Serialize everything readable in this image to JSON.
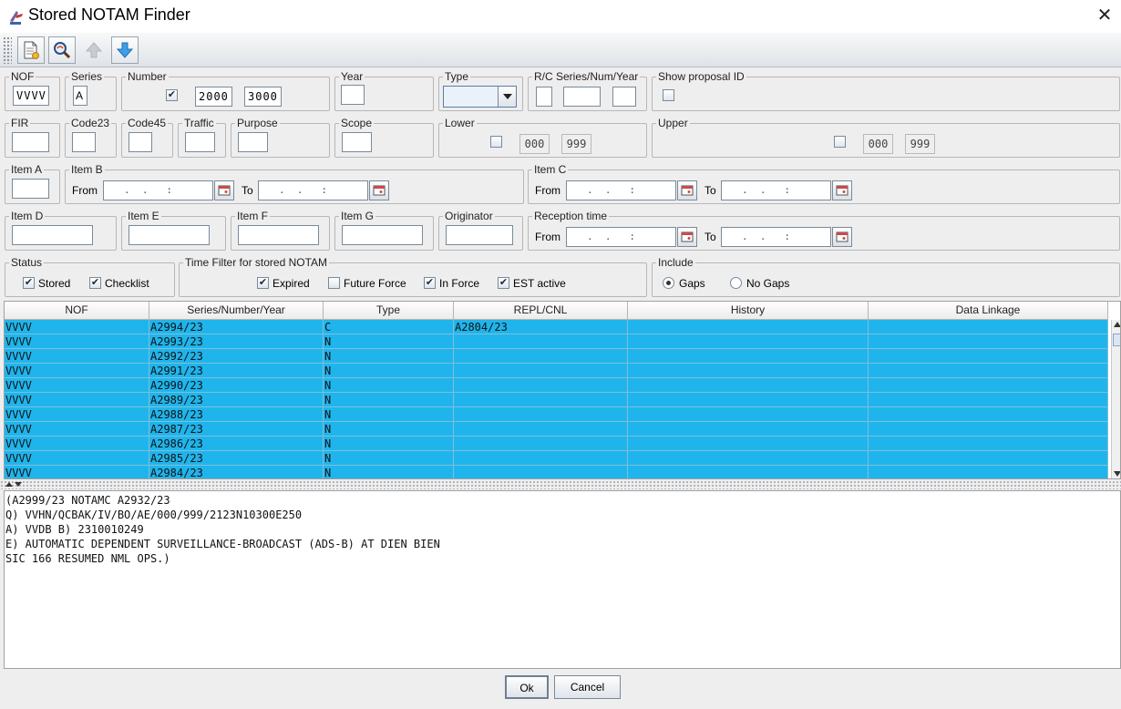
{
  "window": {
    "title": "Stored NOTAM Finder",
    "close_glyph": "✕"
  },
  "toolbar": {
    "icons": [
      "new-document-icon",
      "search-magnifier-icon",
      "arrow-up-icon",
      "arrow-down-icon"
    ]
  },
  "row1": {
    "nof": {
      "title": "NOF",
      "value": "VVVV"
    },
    "series": {
      "title": "Series",
      "value": "A"
    },
    "number": {
      "title": "Number",
      "checked": "✔",
      "from": "2000",
      "to": "3000"
    },
    "year": {
      "title": "Year",
      "value": ""
    },
    "type": {
      "title": "Type",
      "value": ""
    },
    "rc": {
      "title": "R/C Series/Num/Year"
    },
    "proposal": {
      "title": "Show proposal ID"
    }
  },
  "row2": {
    "fir": {
      "title": "FIR"
    },
    "code23": {
      "title": "Code23"
    },
    "code45": {
      "title": "Code45"
    },
    "traffic": {
      "title": "Traffic"
    },
    "purpose": {
      "title": "Purpose"
    },
    "scope": {
      "title": "Scope"
    },
    "lower": {
      "title": "Lower",
      "min": "000",
      "max": "999"
    },
    "upper": {
      "title": "Upper",
      "min": "000",
      "max": "999"
    }
  },
  "row3": {
    "item_a": {
      "title": "Item A"
    },
    "item_b": {
      "title": "Item B",
      "from_label": "From",
      "to_label": "To",
      "mask": ".  .   :"
    },
    "item_c": {
      "title": "Item C",
      "from_label": "From",
      "to_label": "To",
      "mask": ".  .   :"
    }
  },
  "row4": {
    "item_d": {
      "title": "Item D"
    },
    "item_e": {
      "title": "Item E"
    },
    "item_f": {
      "title": "Item F"
    },
    "item_g": {
      "title": "Item G"
    },
    "originator": {
      "title": "Originator"
    },
    "reception": {
      "title": "Reception time",
      "from_label": "From",
      "to_label": "To",
      "mask": ".  .   :"
    }
  },
  "row5": {
    "status": {
      "title": "Status",
      "stored": "Stored",
      "checklist": "Checklist"
    },
    "timefilter": {
      "title": "Time Filter for stored NOTAM",
      "expired": "Expired",
      "future": "Future Force",
      "inforce": "In Force",
      "est": "EST active"
    },
    "include": {
      "title": "Include",
      "gaps": "Gaps",
      "nogaps": "No Gaps"
    }
  },
  "checkmark": "✔",
  "table": {
    "columns": [
      "NOF",
      "Series/Number/Year",
      "Type",
      "REPL/CNL",
      "History",
      "Data Linkage"
    ],
    "rows": [
      [
        "VVVV",
        "A2994/23",
        "C",
        "A2804/23",
        "",
        ""
      ],
      [
        "VVVV",
        "A2993/23",
        "N",
        "",
        "",
        ""
      ],
      [
        "VVVV",
        "A2992/23",
        "N",
        "",
        "",
        ""
      ],
      [
        "VVVV",
        "A2991/23",
        "N",
        "",
        "",
        ""
      ],
      [
        "VVVV",
        "A2990/23",
        "N",
        "",
        "",
        ""
      ],
      [
        "VVVV",
        "A2989/23",
        "N",
        "",
        "",
        ""
      ],
      [
        "VVVV",
        "A2988/23",
        "N",
        "",
        "",
        ""
      ],
      [
        "VVVV",
        "A2987/23",
        "N",
        "",
        "",
        ""
      ],
      [
        "VVVV",
        "A2986/23",
        "N",
        "",
        "",
        ""
      ],
      [
        "VVVV",
        "A2985/23",
        "N",
        "",
        "",
        ""
      ],
      [
        "VVVV",
        "A2984/23",
        "N",
        "",
        "",
        ""
      ]
    ],
    "selected_color": "#1fb5ec"
  },
  "notam_text": [
    "(A2999/23 NOTAMC A2932/23",
    "Q) VVHN/QCBAK/IV/BO/AE/000/999/2123N10300E250",
    "A) VVDB B) 2310010249",
    "E) AUTOMATIC DEPENDENT SURVEILLANCE-BROADCAST (ADS-B) AT DIEN BIEN",
    "SIC 166 RESUMED NML OPS.)"
  ],
  "buttons": {
    "ok": "Ok",
    "cancel": "Cancel"
  }
}
